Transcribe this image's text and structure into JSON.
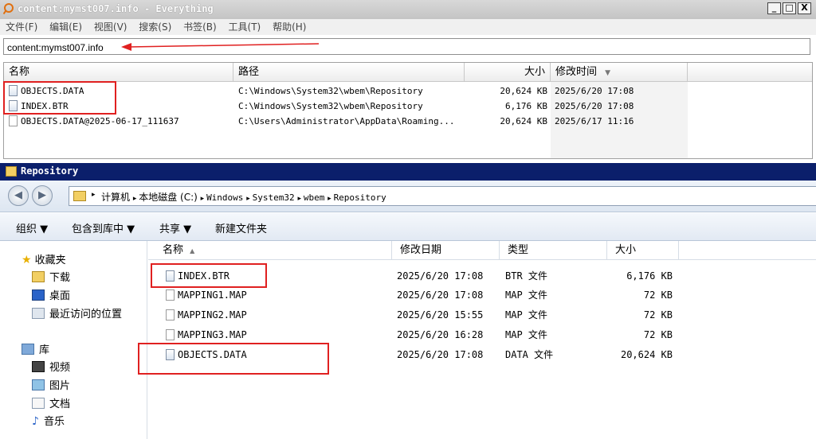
{
  "everything": {
    "title": "content:mymst007.info - Everything",
    "menu": [
      "文件(F)",
      "编辑(E)",
      "视图(V)",
      "搜索(S)",
      "书签(B)",
      "工具(T)",
      "帮助(H)"
    ],
    "search_value": "content:mymst007.info",
    "columns": {
      "name": "名称",
      "path": "路径",
      "size": "大小",
      "modified": "修改时间"
    },
    "rows": [
      {
        "name": "OBJECTS.DATA",
        "path": "C:\\Windows\\System32\\wbem\\Repository",
        "size": "20,624 KB",
        "modified": "2025/6/20 17:08"
      },
      {
        "name": "INDEX.BTR",
        "path": "C:\\Windows\\System32\\wbem\\Repository",
        "size": "6,176 KB",
        "modified": "2025/6/20 17:08"
      },
      {
        "name": "OBJECTS.DATA@2025-06-17_111637",
        "path": "C:\\Users\\Administrator\\AppData\\Roaming...",
        "size": "20,624 KB",
        "modified": "2025/6/17 11:16"
      }
    ],
    "window_buttons": {
      "minimize": "_",
      "maximize": "□",
      "close": "X"
    }
  },
  "explorer": {
    "title": "Repository",
    "breadcrumb": [
      "计算机",
      "本地磁盘 (C:)",
      "Windows",
      "System32",
      "wbem",
      "Repository"
    ],
    "toolbar": {
      "organize": "组织 ▼",
      "include": "包含到库中 ▼",
      "share": "共享 ▼",
      "new_folder": "新建文件夹"
    },
    "sidebar": {
      "favorites": "收藏夹",
      "favorite_items": [
        "下载",
        "桌面",
        "最近访问的位置"
      ],
      "libraries": "库",
      "library_items": [
        "视频",
        "图片",
        "文档",
        "音乐"
      ]
    },
    "columns": {
      "name": "名称",
      "date": "修改日期",
      "type": "类型",
      "size": "大小"
    },
    "rows": [
      {
        "name": "INDEX.BTR",
        "date": "2025/6/20 17:08",
        "type": "BTR 文件",
        "size": "6,176 KB"
      },
      {
        "name": "MAPPING1.MAP",
        "date": "2025/6/20 17:08",
        "type": "MAP 文件",
        "size": "72 KB"
      },
      {
        "name": "MAPPING2.MAP",
        "date": "2025/6/20 15:55",
        "type": "MAP 文件",
        "size": "72 KB"
      },
      {
        "name": "MAPPING3.MAP",
        "date": "2025/6/20 16:28",
        "type": "MAP 文件",
        "size": "72 KB"
      },
      {
        "name": "OBJECTS.DATA",
        "date": "2025/6/20 17:08",
        "type": "DATA 文件",
        "size": "20,624 KB"
      }
    ]
  },
  "colors": {
    "highlight_red": "#e02020",
    "explorer_title_bg": "#0b1f6b"
  }
}
